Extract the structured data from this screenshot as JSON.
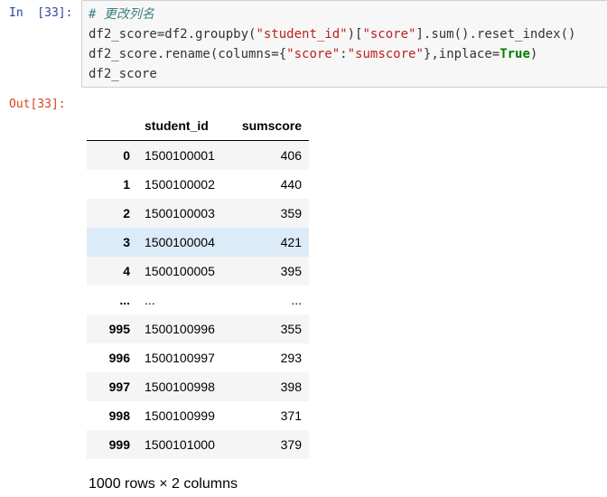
{
  "cell": {
    "in_prompt": "In  [33]:",
    "out_prompt": "Out[33]:",
    "code": {
      "comment": "# 更改列名",
      "line1_a": "df2_score=df2.groupby(",
      "line1_s1": "\"student_id\"",
      "line1_b": ")[",
      "line1_s2": "\"score\"",
      "line1_c": "].sum().reset_index()",
      "line2_a": "df2_score.rename(columns={",
      "line2_s1": "\"score\"",
      "line2_b": ":",
      "line2_s2": "\"sumscore\"",
      "line2_c": "},inplace=",
      "line2_kw": "True",
      "line2_d": ")",
      "line3": "df2_score"
    }
  },
  "table": {
    "index_header": "",
    "columns": [
      "student_id",
      "sumscore"
    ],
    "rows": [
      {
        "index": "0",
        "student_id": "1500100001",
        "sumscore": "406"
      },
      {
        "index": "1",
        "student_id": "1500100002",
        "sumscore": "440"
      },
      {
        "index": "2",
        "student_id": "1500100003",
        "sumscore": "359"
      },
      {
        "index": "3",
        "student_id": "1500100004",
        "sumscore": "421"
      },
      {
        "index": "4",
        "student_id": "1500100005",
        "sumscore": "395"
      },
      {
        "index": "...",
        "student_id": "...",
        "sumscore": "..."
      },
      {
        "index": "995",
        "student_id": "1500100996",
        "sumscore": "355"
      },
      {
        "index": "996",
        "student_id": "1500100997",
        "sumscore": "293"
      },
      {
        "index": "997",
        "student_id": "1500100998",
        "sumscore": "398"
      },
      {
        "index": "998",
        "student_id": "1500100999",
        "sumscore": "371"
      },
      {
        "index": "999",
        "student_id": "1500101000",
        "sumscore": "379"
      }
    ],
    "hover_row": 3,
    "hover_color": "#dcebf8",
    "summary": "1000 rows × 2 columns"
  }
}
